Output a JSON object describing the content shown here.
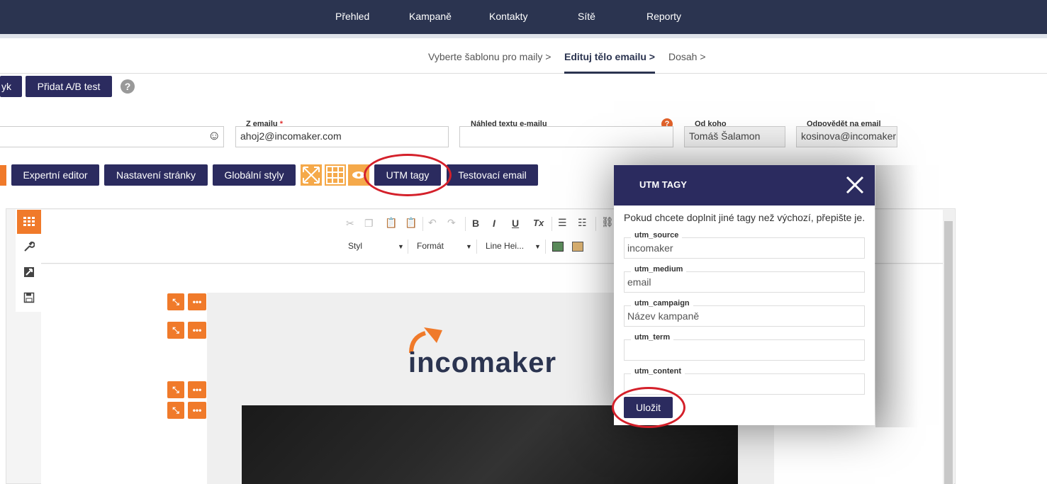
{
  "topnav": {
    "items": [
      "Přehled",
      "Kampaně",
      "Kontakty",
      "Sítě",
      "Reporty"
    ]
  },
  "steps": {
    "items": [
      "Vyberte šablonu pro maily",
      "Edituj tělo emailu",
      "Dosah"
    ],
    "separator": ">"
  },
  "actions": {
    "lang_partial": "yk",
    "ab_test": "Přidat A/B test",
    "help": "?"
  },
  "fields": {
    "from_email": {
      "label": "Z emailu",
      "required_mark": "*",
      "value": "ahoj2@incomaker.com"
    },
    "preview": {
      "label": "Náhled textu e-mailu",
      "help": "?"
    },
    "from_name": {
      "label": "Od koho",
      "value": "Tomáš Šalamon"
    },
    "reply_to": {
      "label": "Odpovědět na email",
      "value": "kosinova@incomaker"
    },
    "emoji": "☺"
  },
  "toolbar": {
    "expert": "Expertní editor",
    "page_settings": "Nastavení stránky",
    "global_styles": "Globální styly",
    "utm": "UTM tagy",
    "test_email": "Testovací email"
  },
  "editor": {
    "combos": [
      "Styl",
      "Formát",
      "Line Hei..."
    ],
    "format": {
      "bold": "B",
      "italic": "I",
      "underline": "U",
      "clear": "Tx"
    },
    "row_more": "•••",
    "logo_text": "incomaker"
  },
  "modal": {
    "title": "UTM TAGY",
    "description": "Pokud chcete doplnit jiné tagy než výchozí, přepište je.",
    "fields": [
      {
        "label": "utm_source",
        "value": "incomaker"
      },
      {
        "label": "utm_medium",
        "value": "email"
      },
      {
        "label": "utm_campaign",
        "value": "Název kampaně"
      },
      {
        "label": "utm_term",
        "value": ""
      },
      {
        "label": "utm_content",
        "value": ""
      }
    ],
    "save": "Uložit"
  },
  "colors": {
    "nav": "#2b3450",
    "button": "#2b2b5f",
    "accent": "#f07a2a",
    "highlight": "#d4202a"
  }
}
